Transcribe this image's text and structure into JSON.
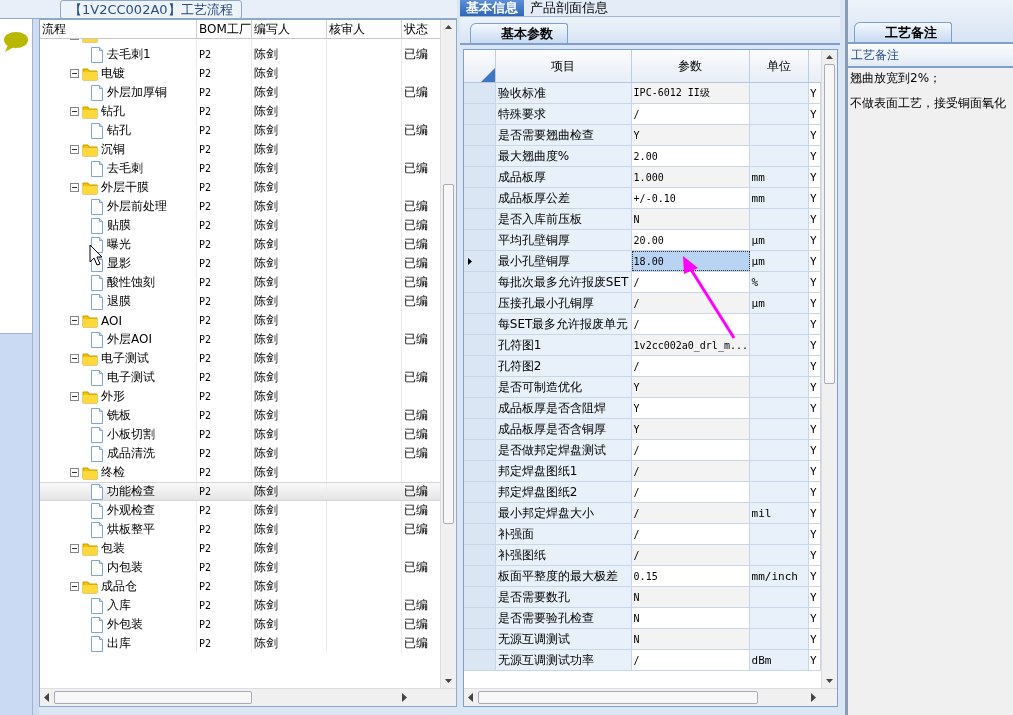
{
  "flow_panel": {
    "title": "【1V2CC002A0】工艺流程",
    "columns": [
      "流程",
      "BOM工厂",
      "编写人",
      "核审人",
      "状态"
    ],
    "tree": [
      {
        "expanded": true,
        "children": [
          {
            "label": "去毛刺1",
            "bom": "P2",
            "author": "陈剑",
            "status": "已编",
            "selected": false
          }
        ]
      },
      {
        "label": "电镀",
        "bom": "P2",
        "author": "陈剑",
        "expanded": true,
        "children": [
          {
            "label": "外层加厚铜",
            "bom": "P2",
            "author": "陈剑",
            "status": "已编",
            "selected": false
          }
        ]
      },
      {
        "label": "钻孔",
        "bom": "P2",
        "author": "陈剑",
        "expanded": true,
        "children": [
          {
            "label": "钻孔",
            "bom": "P2",
            "author": "陈剑",
            "status": "已编",
            "selected": false
          }
        ]
      },
      {
        "label": "沉铜",
        "bom": "P2",
        "author": "陈剑",
        "expanded": true,
        "children": [
          {
            "label": "去毛刺",
            "bom": "P2",
            "author": "陈剑",
            "status": "已编",
            "selected": false
          }
        ]
      },
      {
        "label": "外层干膜",
        "bom": "P2",
        "author": "陈剑",
        "expanded": true,
        "children": [
          {
            "label": "外层前处理",
            "bom": "P2",
            "author": "陈剑",
            "status": "已编",
            "selected": false
          },
          {
            "label": "贴膜",
            "bom": "P2",
            "author": "陈剑",
            "status": "已编",
            "selected": false
          },
          {
            "label": "曝光",
            "bom": "P2",
            "author": "陈剑",
            "status": "已编",
            "selected": false
          },
          {
            "label": "显影",
            "bom": "P2",
            "author": "陈剑",
            "status": "已编",
            "selected": false
          },
          {
            "label": "酸性蚀刻",
            "bom": "P2",
            "author": "陈剑",
            "status": "已编",
            "selected": false
          },
          {
            "label": "退膜",
            "bom": "P2",
            "author": "陈剑",
            "status": "已编",
            "selected": false
          }
        ]
      },
      {
        "label": "AOI",
        "bom": "P2",
        "author": "陈剑",
        "expanded": true,
        "children": [
          {
            "label": "外层AOI",
            "bom": "P2",
            "author": "陈剑",
            "status": "已编",
            "selected": false
          }
        ]
      },
      {
        "label": "电子测试",
        "bom": "P2",
        "author": "陈剑",
        "expanded": true,
        "children": [
          {
            "label": "电子测试",
            "bom": "P2",
            "author": "陈剑",
            "status": "已编",
            "selected": false
          }
        ]
      },
      {
        "label": "外形",
        "bom": "P2",
        "author": "陈剑",
        "expanded": true,
        "children": [
          {
            "label": "铣板",
            "bom": "P2",
            "author": "陈剑",
            "status": "已编",
            "selected": false
          },
          {
            "label": "小板切割",
            "bom": "P2",
            "author": "陈剑",
            "status": "已编",
            "selected": false
          },
          {
            "label": "成品清洗",
            "bom": "P2",
            "author": "陈剑",
            "status": "已编",
            "selected": false
          }
        ]
      },
      {
        "label": "终检",
        "bom": "P2",
        "author": "陈剑",
        "expanded": true,
        "children": [
          {
            "label": "功能检查",
            "bom": "P2",
            "author": "陈剑",
            "status": "已编",
            "selected": true
          },
          {
            "label": "外观检查",
            "bom": "P2",
            "author": "陈剑",
            "status": "已编",
            "selected": false
          },
          {
            "label": "烘板整平",
            "bom": "P2",
            "author": "陈剑",
            "status": "已编",
            "selected": false
          }
        ]
      },
      {
        "label": "包装",
        "bom": "P2",
        "author": "陈剑",
        "expanded": true,
        "children": [
          {
            "label": "内包装",
            "bom": "P2",
            "author": "陈剑",
            "status": "已编",
            "selected": false
          }
        ]
      },
      {
        "label": "成品仓",
        "bom": "P2",
        "author": "陈剑",
        "expanded": true,
        "children": [
          {
            "label": "入库",
            "bom": "P2",
            "author": "陈剑",
            "status": "已编",
            "selected": false
          },
          {
            "label": "外包装",
            "bom": "P2",
            "author": "陈剑",
            "status": "已编",
            "selected": false
          },
          {
            "label": "出库",
            "bom": "P2",
            "author": "陈剑",
            "status": "已编",
            "selected": false
          }
        ]
      }
    ]
  },
  "info_panel": {
    "tabs": [
      {
        "label": "基本信息",
        "selected": true
      },
      {
        "label": "产品剖面信息",
        "selected": false
      }
    ],
    "subtab": "基本参数",
    "columns": [
      "项目",
      "参数",
      "单位"
    ],
    "rows": [
      {
        "item": "验收标准",
        "param": "IPC-6012 II级",
        "unit": "",
        "column_4": "Y",
        "selected": false
      },
      {
        "item": "特殊要求",
        "param": "/",
        "unit": "",
        "column_4": "Y",
        "selected": false
      },
      {
        "item": "是否需要翘曲检查",
        "param": "Y",
        "unit": "",
        "column_4": "Y",
        "selected": false
      },
      {
        "item": "最大翘曲度%",
        "param": "2.00",
        "unit": "",
        "column_4": "Y",
        "selected": false
      },
      {
        "item": "成品板厚",
        "param": "1.000",
        "unit": "mm",
        "column_4": "Y",
        "selected": false
      },
      {
        "item": "成品板厚公差",
        "param": "+/-0.10",
        "unit": "mm",
        "column_4": "Y",
        "selected": false
      },
      {
        "item": "是否入库前压板",
        "param": "N",
        "unit": "",
        "column_4": "Y",
        "selected": false
      },
      {
        "item": "平均孔壁铜厚",
        "param": "20.00",
        "unit": "μm",
        "column_4": "Y",
        "selected": false
      },
      {
        "item": "最小孔壁铜厚",
        "param": "18.00",
        "unit": "μm",
        "column_4": "Y",
        "selected": true
      },
      {
        "item": "每批次最多允许报废SET",
        "param": "/",
        "unit": "%",
        "column_4": "Y",
        "selected": false
      },
      {
        "item": "压接孔最小孔铜厚",
        "param": "/",
        "unit": "μm",
        "column_4": "Y",
        "selected": false
      },
      {
        "item": "每SET最多允许报废单元",
        "param": "/",
        "unit": "",
        "column_4": "Y",
        "selected": false
      },
      {
        "item": "孔符图1",
        "param": "1v2cc002a0_drl_m...",
        "unit": "",
        "column_4": "Y",
        "selected": false
      },
      {
        "item": "孔符图2",
        "param": "/",
        "unit": "",
        "column_4": "Y",
        "selected": false
      },
      {
        "item": "是否可制造优化",
        "param": "Y",
        "unit": "",
        "column_4": "Y",
        "selected": false
      },
      {
        "item": "成品板厚是否含阻焊",
        "param": "Y",
        "unit": "",
        "column_4": "Y",
        "selected": false
      },
      {
        "item": "成品板厚是否含铜厚",
        "param": "Y",
        "unit": "",
        "column_4": "Y",
        "selected": false
      },
      {
        "item": "是否做邦定焊盘测试",
        "param": "/",
        "unit": "",
        "column_4": "Y",
        "selected": false
      },
      {
        "item": "邦定焊盘图纸1",
        "param": "/",
        "unit": "",
        "column_4": "Y",
        "selected": false
      },
      {
        "item": "邦定焊盘图纸2",
        "param": "/",
        "unit": "",
        "column_4": "Y",
        "selected": false
      },
      {
        "item": "最小邦定焊盘大小",
        "param": "/",
        "unit": "mil",
        "column_4": "Y",
        "selected": false
      },
      {
        "item": "补强面",
        "param": "/",
        "unit": "",
        "column_4": "Y",
        "selected": false
      },
      {
        "item": "补强图纸",
        "param": "/",
        "unit": "",
        "column_4": "Y",
        "selected": false
      },
      {
        "item": "板面平整度的最大极差",
        "param": "0.15",
        "unit": "mm/inch",
        "column_4": "Y",
        "selected": false
      },
      {
        "item": "是否需要数孔",
        "param": "N",
        "unit": "",
        "column_4": "Y",
        "selected": false
      },
      {
        "item": "是否需要验孔检查",
        "param": "N",
        "unit": "",
        "column_4": "Y",
        "selected": false
      },
      {
        "item": "无源互调测试",
        "param": "N",
        "unit": "",
        "column_4": "Y",
        "selected": false
      },
      {
        "item": "无源互调测试功率",
        "param": "/",
        "unit": "dBm",
        "column_4": "Y",
        "selected": false
      }
    ]
  },
  "notes_panel": {
    "tab": "工艺备注",
    "header": "工艺备注",
    "lines": [
      "翘曲放宽到2%；",
      "不做表面工艺，接受铜面氧化"
    ]
  }
}
